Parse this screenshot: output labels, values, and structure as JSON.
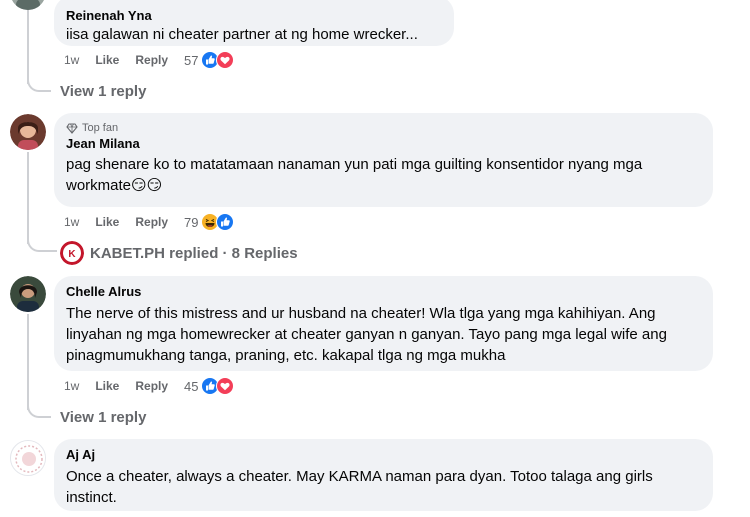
{
  "comments": [
    {
      "author": "Reinenah Yna",
      "text": "iisa galawan ni cheater partner at ng home wrecker...",
      "time": "1w",
      "like_label": "Like",
      "reply_label": "Reply",
      "reaction_count": "57",
      "reactions": [
        "like-icon",
        "love-icon"
      ],
      "view_replies": "View 1 reply"
    },
    {
      "author": "Jean Milana",
      "badge": "Top fan",
      "text": "pag shenare ko to matatamaan nanaman yun pati mga guilting konsentidor nyang mga workmate😏😏",
      "time": "1w",
      "like_label": "Like",
      "reply_label": "Reply",
      "reaction_count": "79",
      "reactions": [
        "haha-icon",
        "like-icon"
      ],
      "replied_by": "KABET.PH replied · 8 Replies"
    },
    {
      "author": "Chelle Alrus",
      "text": "The nerve of this mistress and ur husband na cheater! Wla tlga yang mga kahihiyan. Ang linyahan ng mga homewrecker at cheater ganyan n ganyan. Tayo pang mga legal wife ang pinagmumukhang tanga, praning, etc. kakapal tlga ng mga mukha",
      "time": "1w",
      "like_label": "Like",
      "reply_label": "Reply",
      "reaction_count": "45",
      "reactions": [
        "like-icon",
        "love-icon"
      ],
      "view_replies": "View 1 reply"
    },
    {
      "author": "Aj Aj",
      "text": "Once a cheater, always a cheater. May KARMA naman para dyan. Totoo talaga ang girls instinct."
    }
  ],
  "colors": {
    "bubble": "#f0f2f5",
    "muted_text": "#65676b",
    "like_blue": "#1877f2",
    "love_red": "#f33e58",
    "haha_yellow": "#f7b125"
  }
}
